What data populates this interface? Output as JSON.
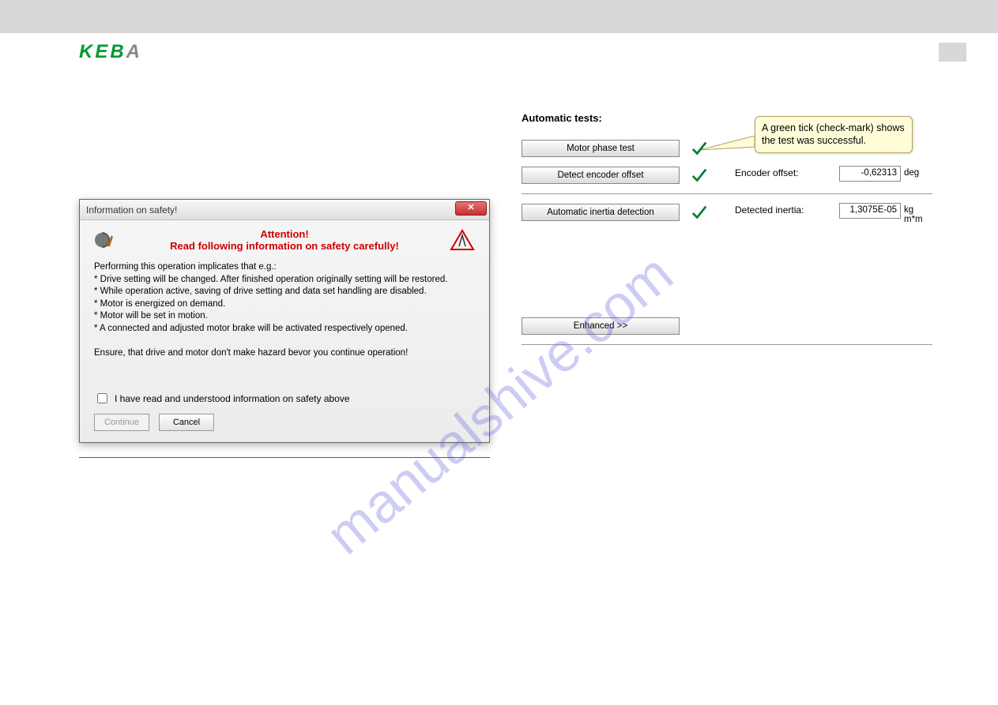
{
  "header": {
    "logo_main": "KEB",
    "logo_last": "A"
  },
  "dialog": {
    "title": "Information on safety!",
    "close_glyph": "✕",
    "attn_line1": "Attention!",
    "attn_line2": "Read following information on safety carefully!",
    "intro": "Performing this operation implicates that e.g.:",
    "b1": "* Drive setting will be changed. After finished operation originally setting will be restored.",
    "b2": "* While operation active, saving of drive setting and data set handling are disabled.",
    "b3": "* Motor is energized on demand.",
    "b4": "* Motor will be set in motion.",
    "b5": "* A connected and adjusted motor brake will be activated respectively opened.",
    "ensure": "Ensure, that drive and motor don't make hazard bevor you continue operation!",
    "consent": "I have read and understood information on safety above",
    "continue_btn": "Continue",
    "cancel_btn": "Cancel"
  },
  "tests": {
    "heading": "Automatic tests:",
    "motor_phase_btn": "Motor phase test",
    "detect_encoder_btn": "Detect encoder offset",
    "encoder_label": "Encoder offset:",
    "encoder_value": "-0,62313",
    "encoder_unit": "deg",
    "inertia_btn": "Automatic inertia detection",
    "inertia_label": "Detected inertia:",
    "inertia_value": "1,3075E-05",
    "inertia_unit": "kg m*m",
    "enhanced_btn": "Enhanced >>"
  },
  "callout": {
    "text": "A green tick (check-mark) shows the test was successful."
  },
  "watermark": "manualshive.com"
}
